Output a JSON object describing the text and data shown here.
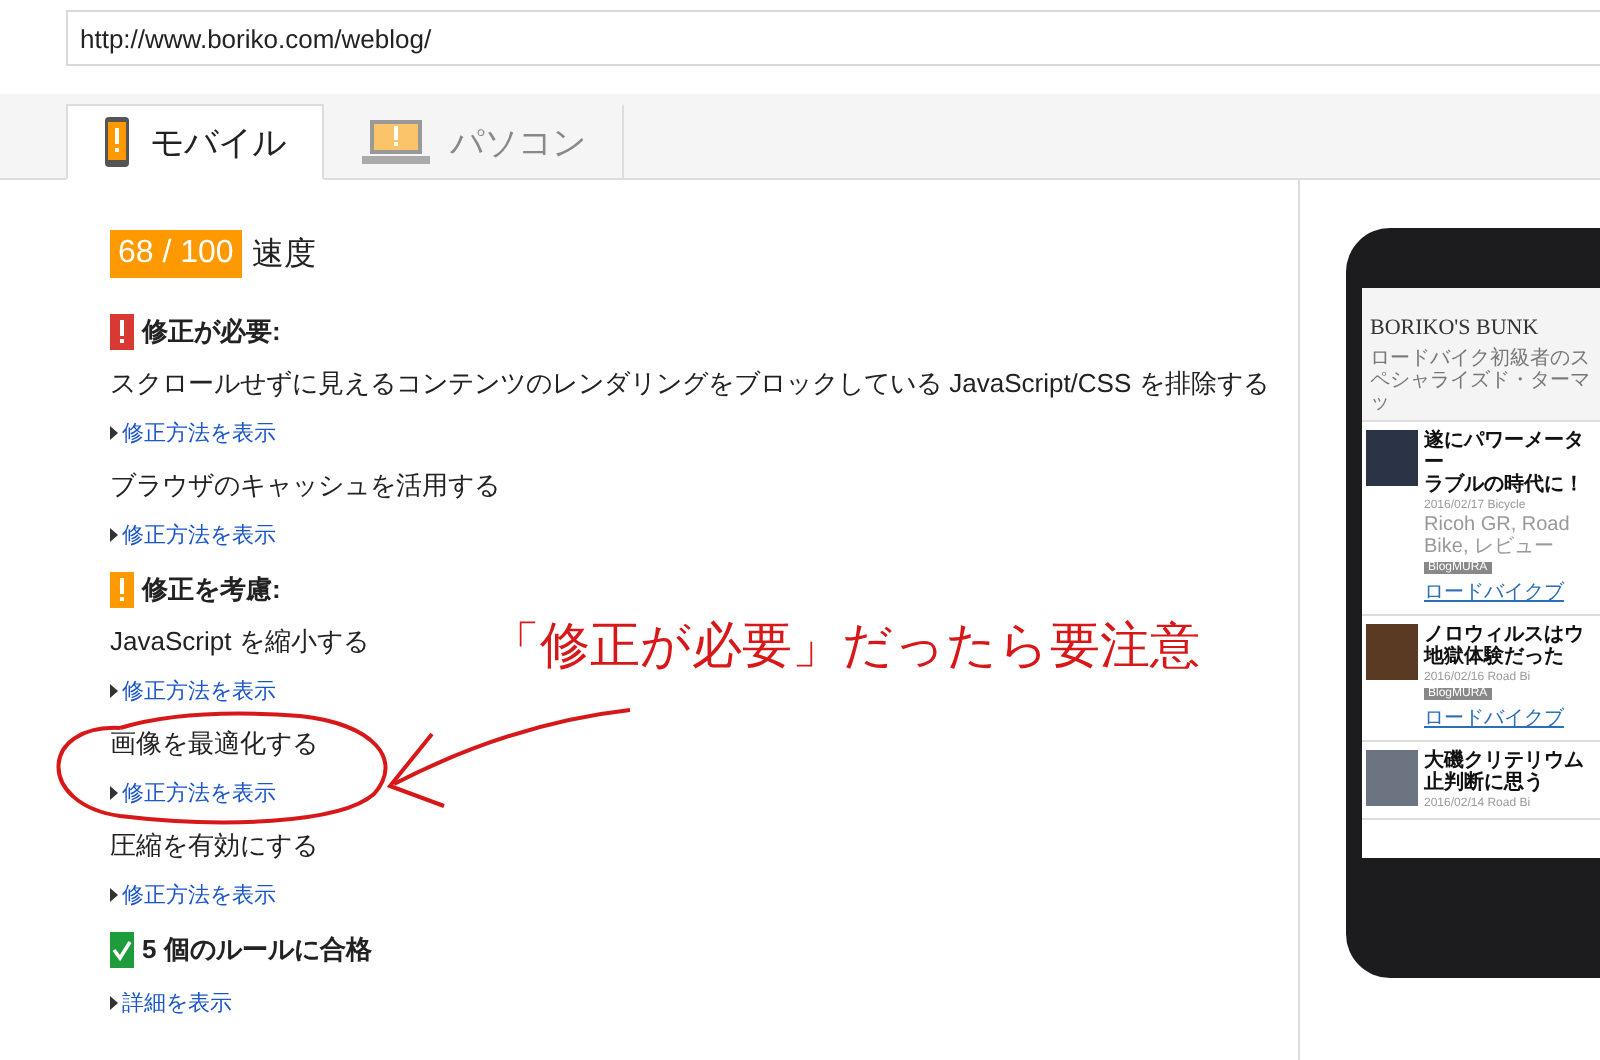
{
  "url": "http://www.boriko.com/weblog/",
  "tabs": [
    {
      "label": "モバイル",
      "selected": true
    },
    {
      "label": "パソコン",
      "selected": false
    }
  ],
  "score": {
    "value": "68 / 100",
    "label": "速度"
  },
  "sections": [
    {
      "kind": "error",
      "title": "修正が必要:",
      "rules": [
        {
          "name": "スクロールせずに見えるコンテンツのレンダリングをブロックしている JavaScript/CSS を排除する",
          "link": "修正方法を表示"
        },
        {
          "name": "ブラウザのキャッシュを活用する",
          "link": "修正方法を表示"
        }
      ]
    },
    {
      "kind": "warning",
      "title": "修正を考慮:",
      "rules": [
        {
          "name": "JavaScript を縮小する",
          "link": "修正方法を表示"
        },
        {
          "name": "画像を最適化する",
          "link": "修正方法を表示"
        },
        {
          "name": "圧縮を有効にする",
          "link": "修正方法を表示"
        }
      ]
    },
    {
      "kind": "pass",
      "title": "5 個のルールに合格",
      "rules": [
        {
          "link": "詳細を表示"
        }
      ]
    }
  ],
  "annotation": {
    "text": "「修正が必要」だったら要注意"
  },
  "preview": {
    "site_title": "BORIKO'S BUNK",
    "tagline": "ロードバイク初級者のスペシャライズド・ターマッ",
    "articles": [
      {
        "title_lines": [
          "遂にパワーメーター",
          "ラブルの時代に！"
        ],
        "date": "2016/02/17",
        "category": "Bicycle",
        "tags": "Ricoh GR, Road Bike, レビュー",
        "badge": "BlogMURA",
        "badge_link": "ロードバイクブ"
      },
      {
        "title_lines": [
          "ノロウィルスはウ",
          "地獄体験だった"
        ],
        "date": "2016/02/16",
        "category": "Road Bi",
        "badge": "BlogMURA",
        "badge_link": "ロードバイクブ"
      },
      {
        "title_lines": [
          "大磯クリテリウム",
          "止判断に思う"
        ],
        "date": "2016/02/14",
        "category": "Road Bi"
      }
    ]
  }
}
